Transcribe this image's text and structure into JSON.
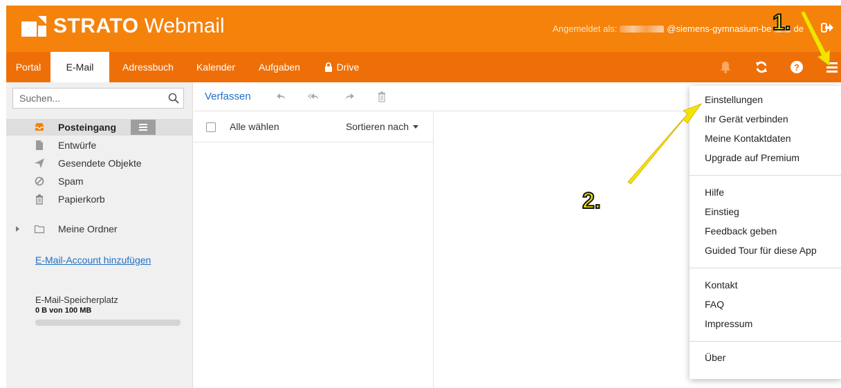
{
  "header": {
    "brand": "STRATO",
    "product": "Webmail",
    "login_prefix": "Angemeldet als:",
    "login_email": "@siemens-gymnasium-be",
    "login_suffix": "de"
  },
  "nav": {
    "tabs": [
      {
        "label": "Portal"
      },
      {
        "label": "E-Mail",
        "active": true
      },
      {
        "label": "Adressbuch"
      },
      {
        "label": "Kalender"
      },
      {
        "label": "Aufgaben"
      },
      {
        "label": "Drive"
      }
    ],
    "right_icons": [
      "bell-icon",
      "refresh-icon",
      "help-icon",
      "hamburger-menu-icon"
    ]
  },
  "sidebar": {
    "search_placeholder": "Suchen...",
    "folders": [
      {
        "label": "Posteingang",
        "icon": "inbox-icon",
        "active": true
      },
      {
        "label": "Entwürfe",
        "icon": "draft-icon"
      },
      {
        "label": "Gesendete Objekte",
        "icon": "sent-icon"
      },
      {
        "label": "Spam",
        "icon": "spam-icon"
      },
      {
        "label": "Papierkorb",
        "icon": "trash-icon"
      }
    ],
    "my_folders": "Meine Ordner",
    "add_account": "E-Mail-Account hinzufügen",
    "storage_label": "E-Mail-Speicherplatz",
    "storage_value": "0 B von 100 MB",
    "storage_fraction": 0
  },
  "toolbar": {
    "compose": "Verfassen"
  },
  "maillist": {
    "select_all": "Alle wählen",
    "sort_by": "Sortieren nach"
  },
  "menu": {
    "groups": [
      [
        "Einstellungen",
        "Ihr Gerät verbinden",
        "Meine Kontaktdaten",
        "Upgrade auf Premium"
      ],
      [
        "Hilfe",
        "Einstieg",
        "Feedback geben",
        "Guided Tour für diese App"
      ],
      [
        "Kontakt",
        "FAQ",
        "Impressum"
      ],
      [
        "Über"
      ]
    ]
  },
  "annotations": {
    "step1": "1.",
    "step2": "2."
  },
  "colors": {
    "brand_orange": "#f5820b",
    "nav_orange": "#ee6f08",
    "link_blue": "#1f6fc1",
    "annotation_yellow": "#f2e400"
  }
}
